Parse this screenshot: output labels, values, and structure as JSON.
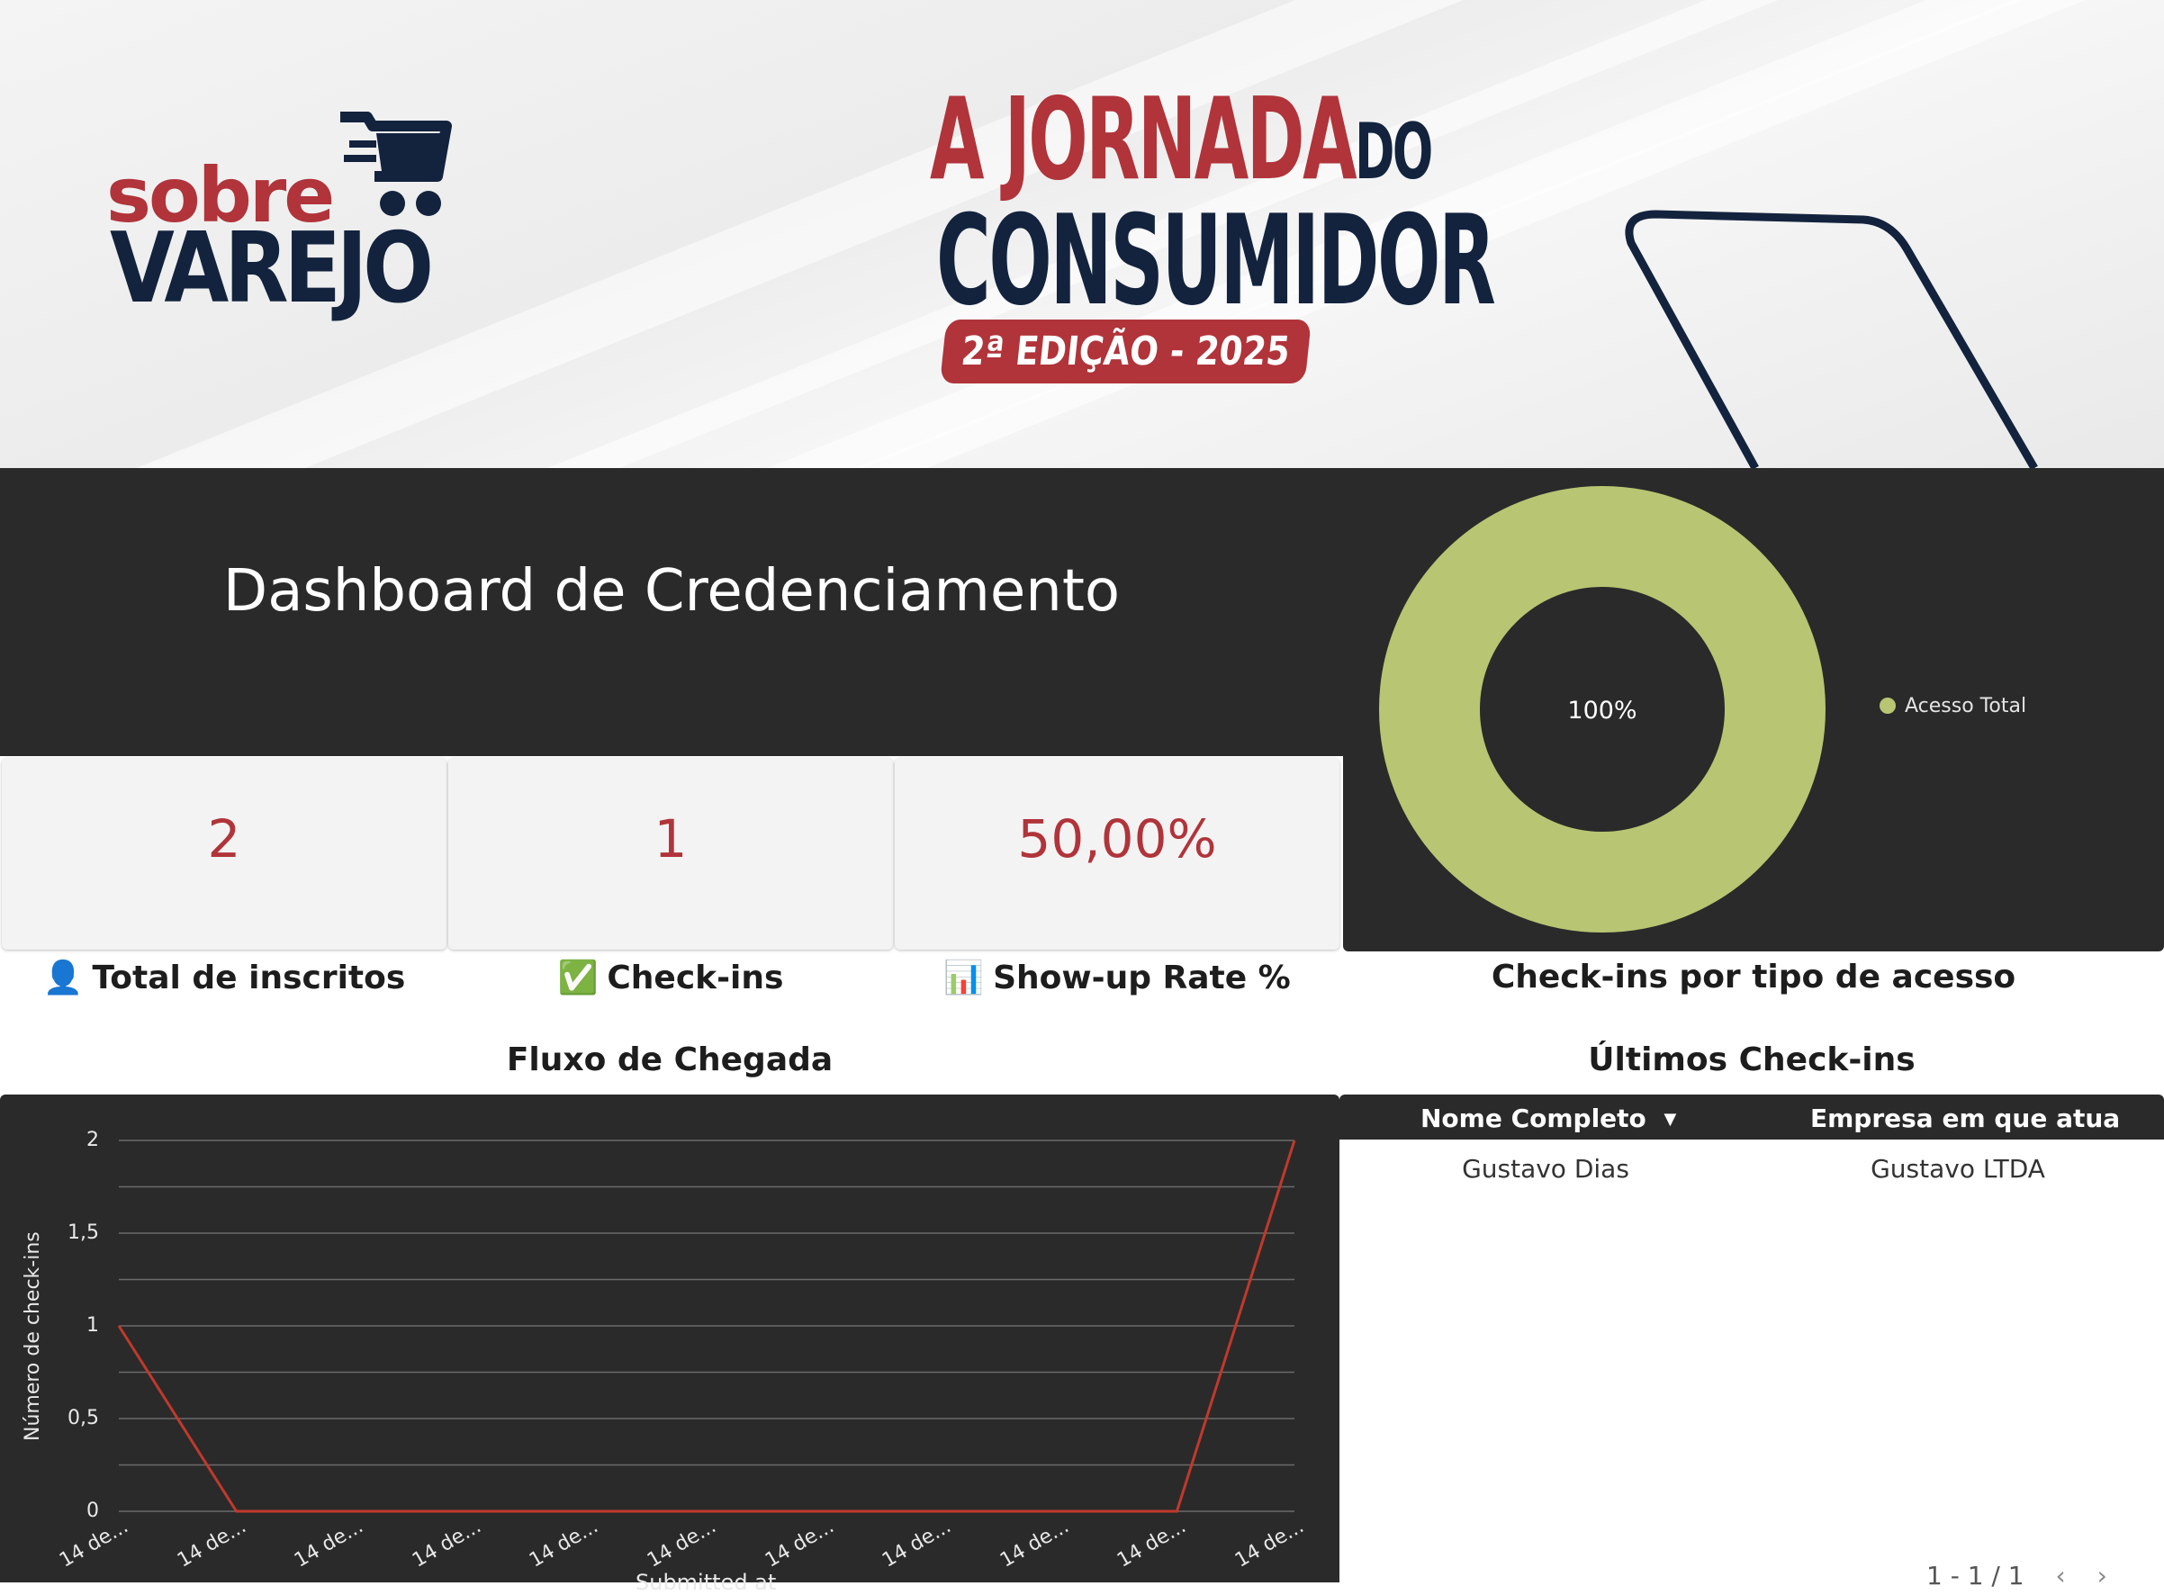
{
  "banner": {
    "brand_top": "sobre",
    "brand_bottom": "VAREJO",
    "event_line1_big": "A JORNADA",
    "event_line1_small": "DO",
    "event_line2": "CONSUMIDOR",
    "event_edition": "2ª EDIÇÃO - 2025"
  },
  "dashboard": {
    "title": "Dashboard de Credenciamento"
  },
  "kpis": [
    {
      "value": "2",
      "label": "Total de inscritos",
      "icon": "👤"
    },
    {
      "value": "1",
      "label": "Check-ins",
      "icon": "✅"
    },
    {
      "value": "50,00%",
      "label": "Show-up Rate %",
      "icon": "📊"
    }
  ],
  "donut": {
    "title": "Check-ins por tipo de acesso",
    "center_label": "100%",
    "legend": "Acesso Total",
    "color": "#b8c572"
  },
  "arrival": {
    "title": "Fluxo de Chegada"
  },
  "latest": {
    "title": "Últimos Check-ins",
    "columns": [
      "Nome Completo",
      "Empresa em que atua"
    ],
    "sort_icon": "sort-down-icon",
    "rows": [
      [
        "Gustavo Dias",
        "Gustavo LTDA"
      ]
    ],
    "pagination": "1 - 1 / 1"
  },
  "chart_data": {
    "type": "line",
    "title": "Fluxo de Chegada",
    "xlabel": "Submitted at",
    "ylabel": "Número de check-ins",
    "y_ticks": [
      "0",
      "0,5",
      "1",
      "1,5",
      "2"
    ],
    "ylim": [
      0,
      2
    ],
    "x": [
      "14 de...",
      "14 de...",
      "14 de...",
      "14 de...",
      "14 de...",
      "14 de...",
      "14 de...",
      "14 de...",
      "14 de...",
      "14 de...",
      "14 de..."
    ],
    "series": [
      {
        "values": [
          1,
          0,
          0,
          0,
          0,
          0,
          0,
          0,
          0,
          0,
          2
        ],
        "color": "#c0392b"
      }
    ],
    "grid": true
  }
}
